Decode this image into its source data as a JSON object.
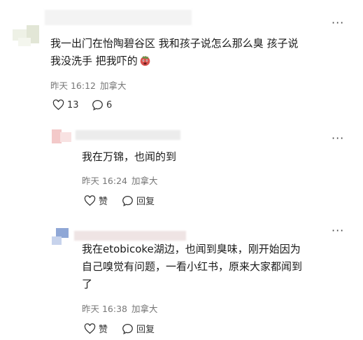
{
  "comments": [
    {
      "text_line1": "我一出门在怡陶碧谷区 我和孩子说怎么那么臭 孩子说",
      "text_line2": "我没洗手 把我吓的",
      "emoji_icon": "frightened-face-emoji",
      "time": "昨天 16:12",
      "location": "加拿大",
      "likes": "13",
      "replies": "6"
    },
    {
      "text": "我在万锦，也闻的到",
      "time": "昨天 16:24",
      "location": "加拿大",
      "like_label": "赞",
      "reply_label": "回复"
    },
    {
      "text_line1": "我在etobicoke湖边，也闻到臭味，刚开始因为",
      "text_line2": "自己嗅觉有问题，一看小红书，原来大家都闻到",
      "text_line3": "了",
      "time": "昨天 16:38",
      "location": "加拿大",
      "like_label": "赞",
      "reply_label": "回复"
    }
  ],
  "icons": {
    "more": "more-dots-icon",
    "like": "heart-icon",
    "comment": "comment-bubble-icon"
  },
  "colors": {
    "text": "#1a1a1a",
    "meta": "#777777",
    "avatar1": "#e9ecdf",
    "avatar2": "#f3d3d3",
    "avatar3": "#9fb4d8"
  }
}
